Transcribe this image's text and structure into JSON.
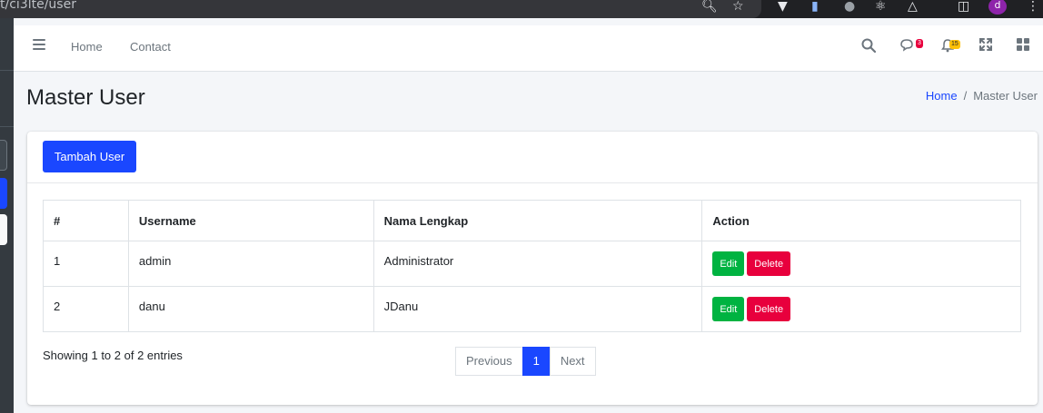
{
  "browser": {
    "url": "t/ci3lte/user",
    "avatar_letter": "d"
  },
  "navbar": {
    "links": [
      "Home",
      "Contact"
    ],
    "messages_badge": "3",
    "notifications_badge": "15"
  },
  "header": {
    "title": "Master User",
    "breadcrumb": {
      "home": "Home",
      "current": "Master User"
    }
  },
  "card": {
    "add_button": "Tambah User",
    "table": {
      "columns": [
        "#",
        "Username",
        "Nama Lengkap",
        "Action"
      ],
      "rows": [
        {
          "no": "1",
          "username": "admin",
          "nama": "Administrator",
          "edit": "Edit",
          "delete": "Delete"
        },
        {
          "no": "2",
          "username": "danu",
          "nama": "JDanu",
          "edit": "Edit",
          "delete": "Delete"
        }
      ]
    },
    "info": "Showing 1 to 2 of 2 entries",
    "pagination": {
      "previous": "Previous",
      "current": "1",
      "next": "Next"
    }
  },
  "colors": {
    "primary": "#1a47ff",
    "success": "#00b341",
    "danger": "#e8003d",
    "warning": "#ffc107",
    "sidebar": "#343a40"
  },
  "icons": [
    "menu-icon",
    "search-icon",
    "comments-icon",
    "bell-icon",
    "expand-icon",
    "th-large-icon"
  ]
}
